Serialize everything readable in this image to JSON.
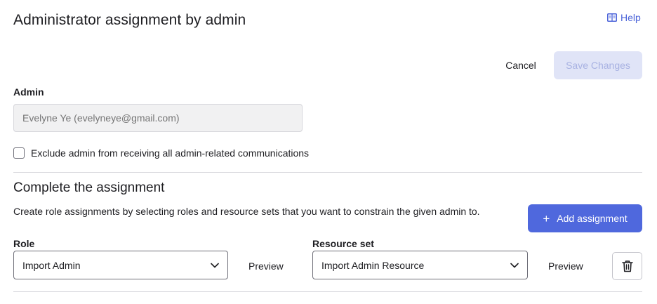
{
  "header": {
    "title": "Administrator assignment by admin",
    "help_label": "Help",
    "help_icon": "book-icon"
  },
  "actions": {
    "cancel_label": "Cancel",
    "save_label": "Save Changes"
  },
  "admin": {
    "label": "Admin",
    "value": "Evelyne Ye (evelyneye@gmail.com)",
    "exclude_label": "Exclude admin from receiving all admin-related communications",
    "exclude_checked": false
  },
  "assignment": {
    "title": "Complete the assignment",
    "description": "Create role assignments by selecting roles and resource sets that you want to constrain the given admin to.",
    "add_label": "Add assignment",
    "role_label": "Role",
    "role_value": "Import Admin",
    "resource_label": "Resource set",
    "resource_value": "Import Admin Resource",
    "preview_label": "Preview",
    "delete_icon": "trash-icon"
  },
  "colors": {
    "accent": "#4f68dd",
    "link": "#4c64d9",
    "disabled_bg": "#e0e4f7",
    "disabled_text": "#a7b1e2"
  }
}
